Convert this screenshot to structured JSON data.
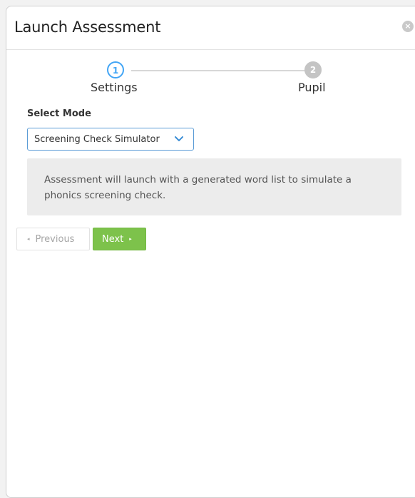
{
  "dialog": {
    "title": "Launch Assessment",
    "close_icon": "close-icon"
  },
  "stepper": {
    "steps": [
      {
        "number": "1",
        "label": "Settings",
        "state": "active"
      },
      {
        "number": "2",
        "label": "Pupil",
        "state": "inactive"
      }
    ]
  },
  "form": {
    "select_mode_label": "Select Mode",
    "mode_selected": "Screening Check Simulator",
    "info_text": "Assessment will launch with a generated word list to simulate a phonics screening check."
  },
  "buttons": {
    "previous_label": "Previous",
    "next_label": "Next",
    "previous_icon": "◂",
    "next_icon": "▸"
  },
  "colors": {
    "accent": "#42a5f5",
    "next_button": "#7dc24b",
    "info_background": "#ececec"
  }
}
